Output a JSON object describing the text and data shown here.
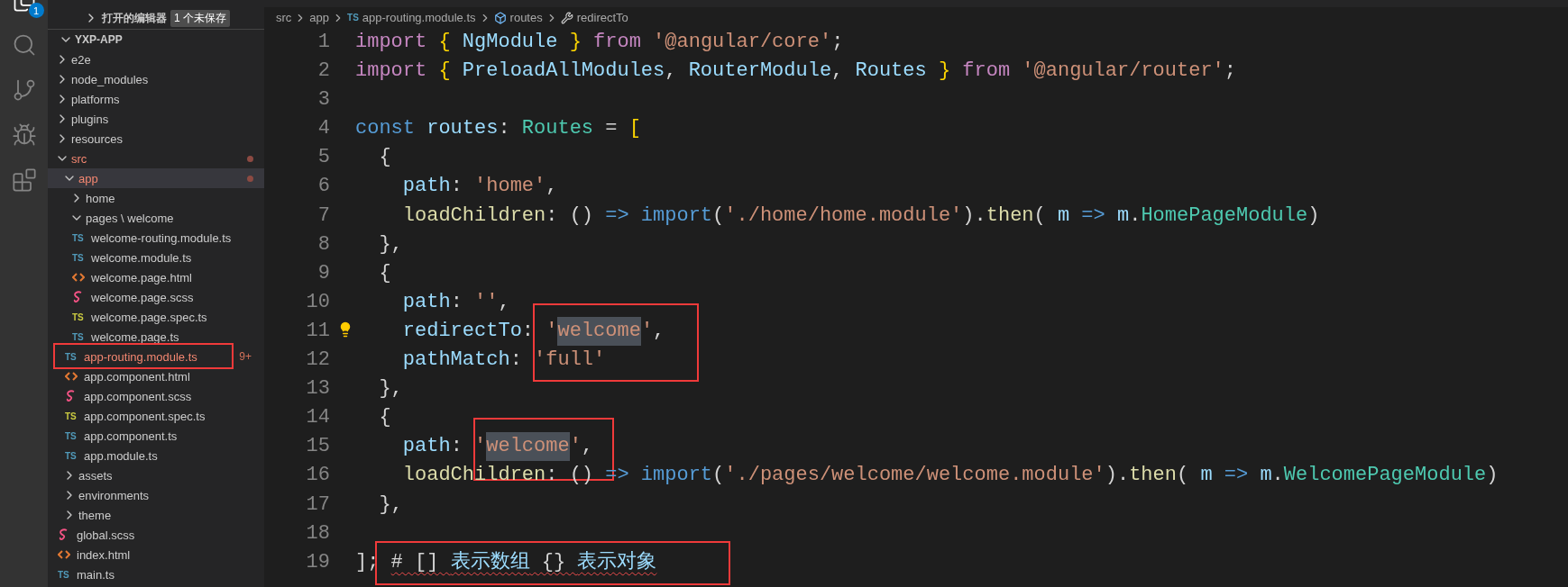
{
  "activity_bar": {
    "items": [
      {
        "kind": "explorer",
        "selected": true,
        "badge": "1"
      },
      {
        "kind": "search",
        "selected": false
      },
      {
        "kind": "source-control",
        "selected": false
      },
      {
        "kind": "run-debug",
        "selected": false
      },
      {
        "kind": "extensions",
        "selected": false
      }
    ]
  },
  "sidebar": {
    "open_editors": {
      "title": "打开的编辑器",
      "expanded": false,
      "badge": "1 个未保存"
    },
    "tree": {
      "label": "YXP-APP",
      "expanded": true,
      "children": [
        {
          "label": "e2e",
          "kind": "folder",
          "expanded": false,
          "has_problems": false,
          "selected": false
        },
        {
          "label": "node_modules",
          "kind": "folder",
          "expanded": false,
          "has_problems": false,
          "selected": false
        },
        {
          "label": "platforms",
          "kind": "folder",
          "expanded": false,
          "has_problems": false,
          "selected": false
        },
        {
          "label": "plugins",
          "kind": "folder",
          "expanded": false,
          "has_problems": false,
          "selected": false
        },
        {
          "label": "resources",
          "kind": "folder",
          "expanded": false,
          "has_problems": false,
          "selected": false
        },
        {
          "label": "src",
          "kind": "folder",
          "expanded": true,
          "has_problems": true,
          "selected": false,
          "children": [
            {
              "label": "app",
              "kind": "folder",
              "expanded": true,
              "has_problems": true,
              "selected": true,
              "children": [
                {
                  "label": "home",
                  "kind": "folder",
                  "expanded": false,
                  "has_problems": false,
                  "selected": false
                },
                {
                  "label": "pages \\ welcome",
                  "kind": "folder",
                  "expanded": true,
                  "has_problems": false,
                  "selected": false,
                  "children": [
                    {
                      "label": "welcome-routing.module.ts",
                      "kind": "ts-file",
                      "icon_text": "TS",
                      "has_problems": false,
                      "selected": false
                    },
                    {
                      "label": "welcome.module.ts",
                      "kind": "ts-file",
                      "icon_text": "TS",
                      "has_problems": false,
                      "selected": false
                    },
                    {
                      "label": "welcome.page.html",
                      "kind": "html-file",
                      "has_problems": false,
                      "selected": false
                    },
                    {
                      "label": "welcome.page.scss",
                      "kind": "scss-file",
                      "has_problems": false,
                      "selected": false
                    },
                    {
                      "label": "welcome.page.spec.ts",
                      "kind": "spec-file",
                      "icon_text": "TS",
                      "has_problems": false,
                      "selected": false
                    },
                    {
                      "label": "welcome.page.ts",
                      "kind": "ts-file",
                      "icon_text": "TS",
                      "has_problems": false,
                      "selected": false
                    }
                  ]
                },
                {
                  "label": "app-routing.module.ts",
                  "kind": "ts-file",
                  "icon_text": "TS",
                  "has_problems": true,
                  "problems": "9+",
                  "boxed": true,
                  "selected": false
                },
                {
                  "label": "app.component.html",
                  "kind": "html-file",
                  "has_problems": false,
                  "selected": false
                },
                {
                  "label": "app.component.scss",
                  "kind": "scss-file",
                  "has_problems": false,
                  "selected": false
                },
                {
                  "label": "app.component.spec.ts",
                  "kind": "spec-file",
                  "icon_text": "TS",
                  "has_problems": false,
                  "selected": false
                },
                {
                  "label": "app.component.ts",
                  "kind": "ts-file",
                  "icon_text": "TS",
                  "has_problems": false,
                  "selected": false
                },
                {
                  "label": "app.module.ts",
                  "kind": "ts-file",
                  "icon_text": "TS",
                  "has_problems": false,
                  "selected": false
                }
              ]
            },
            {
              "label": "assets",
              "kind": "folder",
              "expanded": false,
              "has_problems": false,
              "selected": false
            },
            {
              "label": "environments",
              "kind": "folder",
              "expanded": false,
              "has_problems": false,
              "selected": false
            },
            {
              "label": "theme",
              "kind": "folder",
              "expanded": false,
              "has_problems": false,
              "selected": false
            },
            {
              "label": "global.scss",
              "kind": "scss-file",
              "has_problems": false,
              "selected": false
            },
            {
              "label": "index.html",
              "kind": "html-file",
              "has_problems": false,
              "selected": false
            },
            {
              "label": "main.ts",
              "kind": "ts-file",
              "icon_text": "TS",
              "has_problems": false,
              "selected": false
            }
          ]
        }
      ]
    }
  },
  "breadcrumb": [
    {
      "kind": "folder",
      "label": "src"
    },
    {
      "kind": "folder",
      "label": "app"
    },
    {
      "kind": "ts-file",
      "icon_text": "TS",
      "label": "app-routing.module.ts"
    },
    {
      "kind": "variable",
      "label": "routes"
    },
    {
      "kind": "property",
      "label": "redirectTo"
    }
  ],
  "editor": {
    "lines": [
      {
        "number": "1",
        "lightbulb": false,
        "tokens": [
          {
            "kind": "keyword",
            "text": "import "
          },
          {
            "kind": "brace",
            "text": "{ "
          },
          {
            "kind": "variable",
            "text": "NgModule "
          },
          {
            "kind": "brace",
            "text": "} "
          },
          {
            "kind": "keyword",
            "text": "from "
          },
          {
            "kind": "string",
            "text": "'@angular/core'"
          },
          {
            "kind": "plain",
            "text": ";"
          }
        ]
      },
      {
        "number": "2",
        "lightbulb": false,
        "tokens": [
          {
            "kind": "keyword",
            "text": "import "
          },
          {
            "kind": "brace",
            "text": "{ "
          },
          {
            "kind": "variable",
            "text": "PreloadAllModules"
          },
          {
            "kind": "plain",
            "text": ", "
          },
          {
            "kind": "variable",
            "text": "RouterModule"
          },
          {
            "kind": "plain",
            "text": ", "
          },
          {
            "kind": "variable",
            "text": "Routes "
          },
          {
            "kind": "brace",
            "text": "} "
          },
          {
            "kind": "keyword",
            "text": "from "
          },
          {
            "kind": "string",
            "text": "'@angular/router'"
          },
          {
            "kind": "plain",
            "text": ";"
          }
        ]
      },
      {
        "number": "3",
        "lightbulb": false
      },
      {
        "number": "4",
        "lightbulb": false,
        "tokens": [
          {
            "kind": "storage",
            "text": "const "
          },
          {
            "kind": "variable",
            "text": "routes"
          },
          {
            "kind": "plain",
            "text": ": "
          },
          {
            "kind": "type",
            "text": "Routes"
          },
          {
            "kind": "plain",
            "text": " = "
          },
          {
            "kind": "brace",
            "text": "["
          }
        ]
      },
      {
        "number": "5",
        "lightbulb": false,
        "tokens": [
          {
            "kind": "plain",
            "text": "  {"
          }
        ]
      },
      {
        "number": "6",
        "lightbulb": false,
        "tokens": [
          {
            "kind": "variable",
            "text": "    path"
          },
          {
            "kind": "plain",
            "text": ": "
          },
          {
            "kind": "string",
            "text": "'home'"
          },
          {
            "kind": "plain",
            "text": ","
          }
        ]
      },
      {
        "number": "7",
        "lightbulb": false,
        "tokens": [
          {
            "kind": "function",
            "text": "    loadChildren"
          },
          {
            "kind": "plain",
            "text": ": () "
          },
          {
            "kind": "storage",
            "text": "=> import"
          },
          {
            "kind": "plain",
            "text": "("
          },
          {
            "kind": "string",
            "text": "'./home/home.module'"
          },
          {
            "kind": "plain",
            "text": ")."
          },
          {
            "kind": "function",
            "text": "then"
          },
          {
            "kind": "plain",
            "text": "( "
          },
          {
            "kind": "variable",
            "text": "m "
          },
          {
            "kind": "storage",
            "text": "=> "
          },
          {
            "kind": "variable",
            "text": "m"
          },
          {
            "kind": "plain",
            "text": "."
          },
          {
            "kind": "type",
            "text": "HomePageModule"
          },
          {
            "kind": "plain",
            "text": ")"
          }
        ]
      },
      {
        "number": "8",
        "lightbulb": false,
        "tokens": [
          {
            "kind": "plain",
            "text": "  },"
          }
        ]
      },
      {
        "number": "9",
        "lightbulb": false,
        "tokens": [
          {
            "kind": "plain",
            "text": "  {"
          }
        ]
      },
      {
        "number": "10",
        "lightbulb": false,
        "tokens": [
          {
            "kind": "variable",
            "text": "    path"
          },
          {
            "kind": "plain",
            "text": ": "
          },
          {
            "kind": "string",
            "text": "''"
          },
          {
            "kind": "plain",
            "text": ","
          }
        ]
      },
      {
        "number": "11",
        "lightbulb": true,
        "tokens": [
          {
            "kind": "variable",
            "text": "    redirectTo"
          },
          {
            "kind": "plain",
            "text": ": "
          },
          {
            "kind": "string",
            "text": "'",
            "boxed": true
          },
          {
            "kind": "string",
            "text": "welcome",
            "highlighted": true
          },
          {
            "kind": "string",
            "text": "'"
          },
          {
            "kind": "plain",
            "text": ","
          }
        ]
      },
      {
        "number": "12",
        "lightbulb": false,
        "tokens": [
          {
            "kind": "variable",
            "text": "    pathMatch"
          },
          {
            "kind": "plain",
            "text": ": "
          },
          {
            "kind": "string",
            "text": "'full'"
          }
        ]
      },
      {
        "number": "13",
        "lightbulb": false,
        "tokens": [
          {
            "kind": "plain",
            "text": "  },"
          }
        ]
      },
      {
        "number": "14",
        "lightbulb": false,
        "tokens": [
          {
            "kind": "plain",
            "text": "  {"
          }
        ]
      },
      {
        "number": "15",
        "lightbulb": false,
        "tokens": [
          {
            "kind": "variable",
            "text": "    path"
          },
          {
            "kind": "plain",
            "text": ": "
          },
          {
            "kind": "string",
            "text": "'",
            "boxed": true
          },
          {
            "kind": "string",
            "text": "welcome",
            "highlighted": true
          },
          {
            "kind": "string",
            "text": "'"
          },
          {
            "kind": "plain",
            "text": ","
          }
        ]
      },
      {
        "number": "16",
        "lightbulb": false,
        "tokens": [
          {
            "kind": "function",
            "text": "    loadChildren"
          },
          {
            "kind": "plain",
            "text": ": () "
          },
          {
            "kind": "storage",
            "text": "=> import"
          },
          {
            "kind": "plain",
            "text": "("
          },
          {
            "kind": "string",
            "text": "'./pages/welcome/welcome.module'"
          },
          {
            "kind": "plain",
            "text": ")."
          },
          {
            "kind": "function",
            "text": "then"
          },
          {
            "kind": "plain",
            "text": "( "
          },
          {
            "kind": "variable",
            "text": "m "
          },
          {
            "kind": "storage",
            "text": "=> "
          },
          {
            "kind": "variable",
            "text": "m"
          },
          {
            "kind": "plain",
            "text": "."
          },
          {
            "kind": "type",
            "text": "WelcomePageModule"
          },
          {
            "kind": "plain",
            "text": ")"
          }
        ]
      },
      {
        "number": "17",
        "lightbulb": false,
        "tokens": [
          {
            "kind": "plain",
            "text": "  },"
          }
        ]
      },
      {
        "number": "18",
        "lightbulb": false
      },
      {
        "number": "19",
        "lightbulb": false,
        "tokens": [
          {
            "kind": "plain",
            "text": "]; "
          },
          {
            "kind": "plain",
            "text": "# [] ",
            "error": true,
            "boxed": true
          },
          {
            "kind": "chinese",
            "text": "表示数组",
            "error": true
          },
          {
            "kind": "plain",
            "text": " {} ",
            "error": true
          },
          {
            "kind": "chinese",
            "text": "表示对象",
            "error": true
          }
        ]
      }
    ]
  }
}
